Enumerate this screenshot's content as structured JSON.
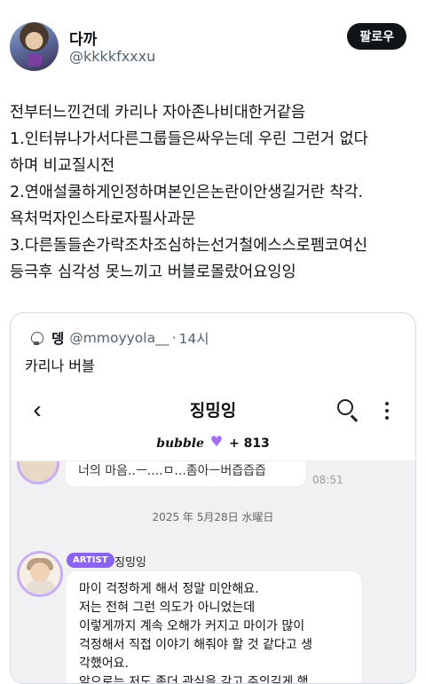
{
  "user": {
    "name": "다까",
    "handle": "@kkkkfxxxu",
    "follow_label": "팔로우"
  },
  "tweet": {
    "lines": [
      "전부터느낀건데 카리나 자아존나비대한거같음",
      "1.인터뷰나가서다른그룹들은싸우는데 우린 그런거 없다",
      "하며 비교질시전",
      "2.연애설쿨하게인정하며본인은논란이안생길거란 착각.",
      "욕처먹자인스타로자필사과문",
      "3.다른돌들손가락조차조심하는선거철에스스로펨코여신",
      "등극후 심각성 못느끼고 버블로몰랐어요잉잉"
    ]
  },
  "quote": {
    "name": "뎅",
    "handle": "@mmoyyola__",
    "dot": "·",
    "time": "14시",
    "text": "카리나 버블",
    "app": {
      "title": "징밍잉",
      "back_icon": "‹",
      "bubble_brand": "bubble",
      "plus_count": "+ 813",
      "prev_message": "너의 마음..ㅡ....ㅁ...좀아ㅡ버즙즙즙",
      "prev_time": "08:51",
      "date": "2025 年 5月28日 水曜日",
      "artist_badge": "ARTIST",
      "sender": "징밍잉",
      "message_lines": [
        "마이 걱정하게 해서 정말 미안해요.",
        "저는 전혀 그런 의도가 아니었는데",
        "이렇게까지 계속 오해가 커지고  마이가 많이",
        "걱정해서 직접 이야기 해줘야 할 것 같다고 생",
        "각했어요.",
        "앞으로는 저도 좀더 관심을 갖고 주의깊게 행"
      ]
    }
  }
}
